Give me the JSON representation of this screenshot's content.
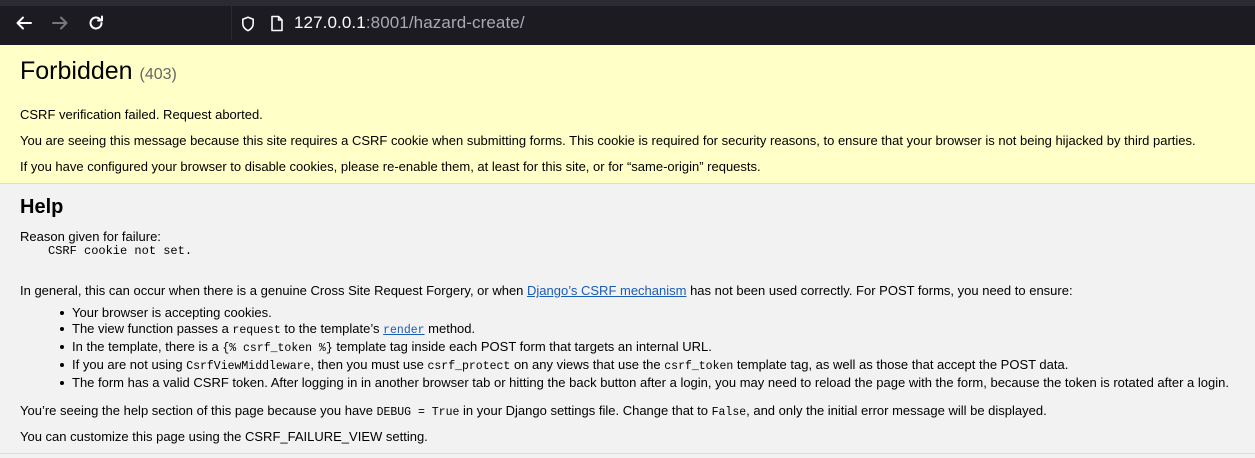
{
  "browser": {
    "url_host": "127.0.0.1",
    "url_rest": ":8001/hazard-create/"
  },
  "summary": {
    "title": "Forbidden",
    "code": "(403)",
    "line1": "CSRF verification failed. Request aborted.",
    "line2": "You are seeing this message because this site requires a CSRF cookie when submitting forms. This cookie is required for security reasons, to ensure that your browser is not being hijacked by third parties.",
    "line3": "If you have configured your browser to disable cookies, please re-enable them, at least for this site, or for “same-origin” requests."
  },
  "help": {
    "title": "Help",
    "reason_label": "Reason given for failure:",
    "reason": "CSRF cookie not set.",
    "general_pre": "In general, this can occur when there is a genuine Cross Site Request Forgery, or when ",
    "general_link": "Django’s CSRF mechanism",
    "general_post": " has not been used correctly. For POST forms, you need to ensure:",
    "bullets": [
      {
        "text": "Your browser is accepting cookies."
      },
      {
        "pre": "The view function passes a ",
        "code": "request",
        "mid": " to the template’s ",
        "link": "render",
        "post": " method."
      },
      {
        "pre": "In the template, there is a ",
        "code": "{% csrf_token %}",
        "post": " template tag inside each POST form that targets an internal URL."
      },
      {
        "pre": "If you are not using ",
        "code1": "CsrfViewMiddleware",
        "mid1": ", then you must use ",
        "code2": "csrf_protect",
        "mid2": " on any views that use the ",
        "code3": "csrf_token",
        "post": " template tag, as well as those that accept the POST data."
      },
      {
        "text": "The form has a valid CSRF token. After logging in in another browser tab or hitting the back button after a login, you may need to reload the page with the form, because the token is rotated after a login."
      }
    ],
    "debug_pre": "You’re seeing the help section of this page because you have ",
    "debug_code1": "DEBUG = True",
    "debug_mid": " in your Django settings file. Change that to ",
    "debug_code2": "False",
    "debug_post": ", and only the initial error message will be displayed.",
    "custom": "You can customize this page using the CSRF_FAILURE_VIEW setting."
  },
  "colors": {
    "summary_bg": "#ffffc8",
    "help_bg": "#f2f2f2",
    "link": "#1a5bb5",
    "chrome_bg": "#1c1b22"
  }
}
